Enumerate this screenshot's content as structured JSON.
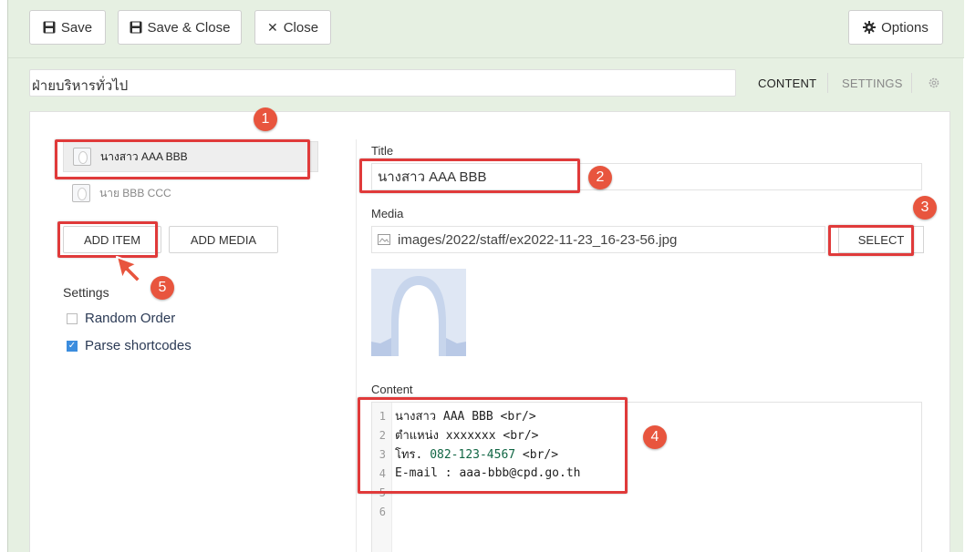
{
  "toolbar": {
    "save_label": "Save",
    "save_close_label": "Save & Close",
    "close_label": "Close",
    "options_label": "Options"
  },
  "module": {
    "title_value": "ฝ่ายบริหารทั่วไป",
    "tabs": [
      "CONTENT",
      "SETTINGS"
    ]
  },
  "items": [
    {
      "label": "นางสาว AAA BBB"
    },
    {
      "label": "นาย BBB CCC"
    }
  ],
  "actions": {
    "add_item": "ADD ITEM",
    "add_media": "ADD MEDIA"
  },
  "settings": {
    "heading": "Settings",
    "options": [
      {
        "label": "Random Order",
        "checked": false
      },
      {
        "label": "Parse shortcodes",
        "checked": true
      }
    ]
  },
  "form": {
    "title_label": "Title",
    "title_value": "นางสาว AAA BBB",
    "media_label": "Media",
    "media_value": "images/2022/staff/ex2022-11-23_16-23-56.jpg",
    "select_label": "SELECT",
    "content_label": "Content"
  },
  "editor": {
    "lines": [
      {
        "n": "1",
        "text": "นางสาว AAA BBB <br/>"
      },
      {
        "n": "2",
        "text": "ตำแหน่ง xxxxxxx <br/>"
      },
      {
        "n": "3",
        "text_pre": "โทร. ",
        "text_num": "082-123-4567",
        "text_post": " <br/>"
      },
      {
        "n": "4",
        "text": "E-mail : aaa-bbb@cpd.go.th"
      },
      {
        "n": "5",
        "text": ""
      },
      {
        "n": "6",
        "text": ""
      }
    ]
  },
  "annotations": [
    "1",
    "2",
    "3",
    "4",
    "5"
  ],
  "colors": {
    "background": "#e6f0e2",
    "annotation_red": "#e03a3a",
    "badge": "#e8553e",
    "checkbox_blue": "#3c8dde"
  }
}
